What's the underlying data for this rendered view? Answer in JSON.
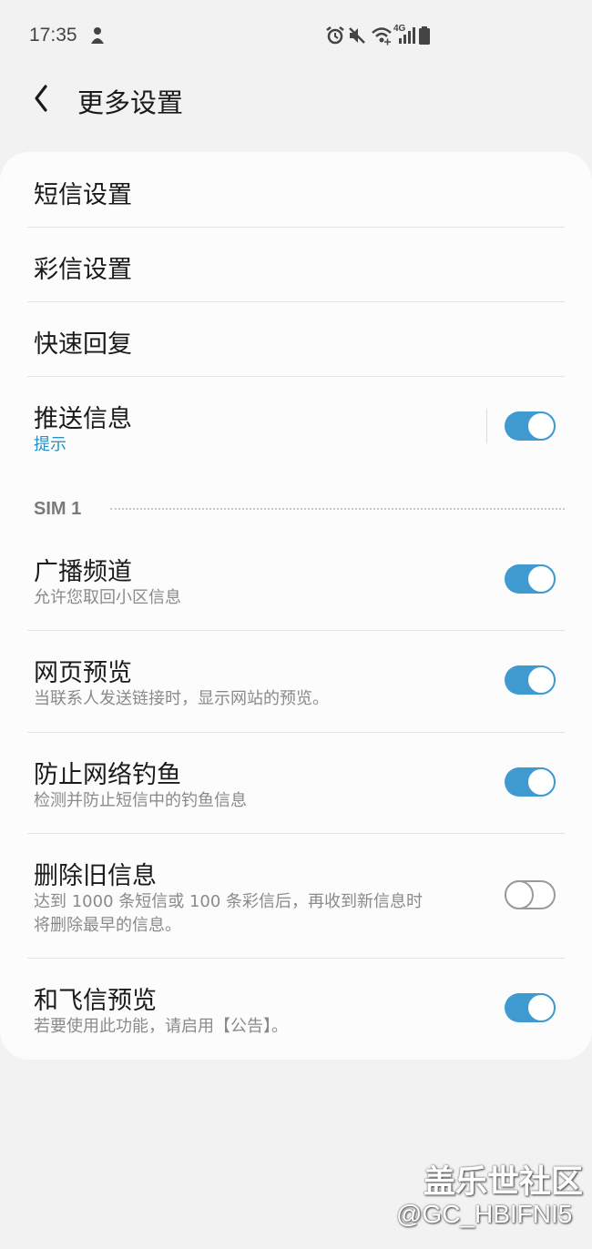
{
  "status_bar": {
    "time": "17:35",
    "network": "4G",
    "icons": [
      "notification-icon",
      "alarm-icon",
      "mute-icon",
      "wifi-icon",
      "signal-icon",
      "battery-icon"
    ]
  },
  "header": {
    "title": "更多设置",
    "back_icon": "back-arrow-icon"
  },
  "menu": {
    "sms_settings": "短信设置",
    "mms_settings": "彩信设置",
    "quick_reply": "快速回复"
  },
  "push": {
    "title": "推送信息",
    "subtitle": "提示",
    "enabled": true
  },
  "sim_section": {
    "label": "SIM 1"
  },
  "settings": [
    {
      "title": "广播频道",
      "subtitle": "允许您取回小区信息",
      "enabled": true
    },
    {
      "title": "网页预览",
      "subtitle": "当联系人发送链接时，显示网站的预览。",
      "enabled": true
    },
    {
      "title": "防止网络钓鱼",
      "subtitle": "检测并防止短信中的钓鱼信息",
      "enabled": true
    },
    {
      "title": "删除旧信息",
      "subtitle_line1": "达到 1000 条短信或 100 条彩信后，再收到新信息时",
      "subtitle_line2": "将删除最早的信息。",
      "enabled": false
    },
    {
      "title": "和飞信预览",
      "subtitle": "若要使用此功能，请启用【公告】。",
      "enabled": true
    }
  ],
  "watermark": {
    "title": "盖乐世社区",
    "handle": "@GC_HBIFNI5"
  },
  "colors": {
    "accent": "#3f9ad0",
    "link": "#2a8fc4",
    "background": "#f2f2f2",
    "card": "#fcfcfc"
  }
}
